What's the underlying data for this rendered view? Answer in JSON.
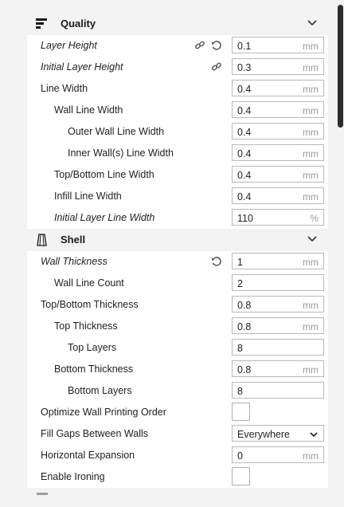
{
  "sections": {
    "quality": {
      "title": "Quality",
      "icon": "quality-icon"
    },
    "shell": {
      "title": "Shell",
      "icon": "shell-icon"
    }
  },
  "quality_rows": [
    {
      "label": "Layer Height",
      "value": "0.1",
      "unit": "mm",
      "italic": true,
      "icons": [
        "link-icon",
        "reset-icon"
      ]
    },
    {
      "label": "Initial Layer Height",
      "value": "0.3",
      "unit": "mm",
      "italic": true,
      "icons": [
        "link-icon"
      ]
    },
    {
      "label": "Line Width",
      "value": "0.4",
      "unit": "mm"
    },
    {
      "label": "Wall Line Width",
      "value": "0.4",
      "unit": "mm"
    },
    {
      "label": "Outer Wall Line Width",
      "value": "0.4",
      "unit": "mm"
    },
    {
      "label": "Inner Wall(s) Line Width",
      "value": "0.4",
      "unit": "mm"
    },
    {
      "label": "Top/Bottom Line Width",
      "value": "0.4",
      "unit": "mm"
    },
    {
      "label": "Infill Line Width",
      "value": "0.4",
      "unit": "mm"
    },
    {
      "label": "Initial Layer Line Width",
      "value": "110",
      "unit": "%",
      "italic": true
    }
  ],
  "shell_rows": [
    {
      "label": "Wall Thickness",
      "value": "1",
      "unit": "mm",
      "italic": true,
      "icons": [
        "reset-icon"
      ]
    },
    {
      "label": "Wall Line Count",
      "value": "2",
      "unit": ""
    },
    {
      "label": "Top/Bottom Thickness",
      "value": "0.8",
      "unit": "mm"
    },
    {
      "label": "Top Thickness",
      "value": "0.8",
      "unit": "mm"
    },
    {
      "label": "Top Layers",
      "value": "8",
      "unit": ""
    },
    {
      "label": "Bottom Thickness",
      "value": "0.8",
      "unit": "mm"
    },
    {
      "label": "Bottom Layers",
      "value": "8",
      "unit": ""
    },
    {
      "label": "Optimize Wall Printing Order",
      "type": "checkbox",
      "checked": false
    },
    {
      "label": "Fill Gaps Between Walls",
      "type": "select",
      "value": "Everywhere"
    },
    {
      "label": "Horizontal Expansion",
      "value": "0",
      "unit": "mm"
    },
    {
      "label": "Enable Ironing",
      "type": "checkbox",
      "checked": false
    }
  ],
  "colors": {
    "panel_bg": "#f3f3f3",
    "row_bg": "#ffffff",
    "field_border": "#b9b9b9",
    "unit_text": "#9a9a9a",
    "scrollbar": "#2d2d2d"
  }
}
